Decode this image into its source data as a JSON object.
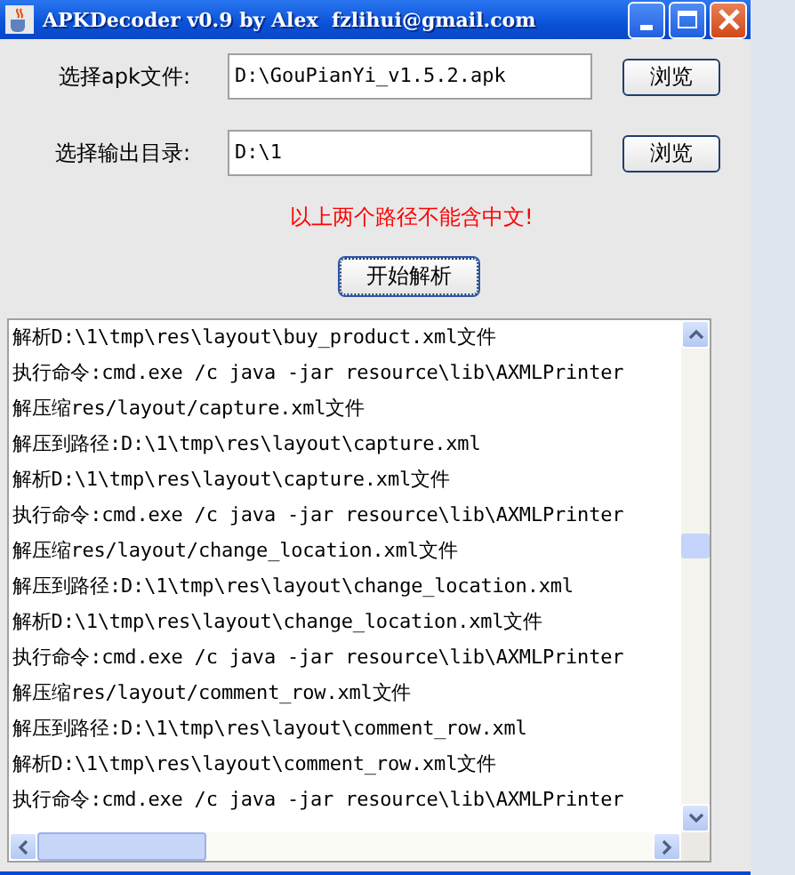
{
  "window": {
    "title": "APKDecoder v0.9 by Alex  fzlihui@gmail.com"
  },
  "fields": [
    {
      "label": "选择apk文件:",
      "value": "D:\\GouPianYi_v1.5.2.apk",
      "button": "浏览"
    },
    {
      "label": "选择输出目录:",
      "value": "D:\\1",
      "button": "浏览"
    }
  ],
  "warning": "以上两个路径不能含中文!",
  "start_button": "开始解析",
  "log": [
    "解析D:\\1\\tmp\\res\\layout\\buy_product.xml文件",
    "执行命令:cmd.exe /c java -jar resource\\lib\\AXMLPrinter",
    "解压缩res/layout/capture.xml文件",
    "解压到路径:D:\\1\\tmp\\res\\layout\\capture.xml",
    "解析D:\\1\\tmp\\res\\layout\\capture.xml文件",
    "执行命令:cmd.exe /c java -jar resource\\lib\\AXMLPrinter",
    "解压缩res/layout/change_location.xml文件",
    "解压到路径:D:\\1\\tmp\\res\\layout\\change_location.xml",
    "解析D:\\1\\tmp\\res\\layout\\change_location.xml文件",
    "执行命令:cmd.exe /c java -jar resource\\lib\\AXMLPrinter",
    "解压缩res/layout/comment_row.xml文件",
    "解压到路径:D:\\1\\tmp\\res\\layout\\comment_row.xml",
    "解析D:\\1\\tmp\\res\\layout\\comment_row.xml文件",
    "执行命令:cmd.exe /c java -jar resource\\lib\\AXMLPrinter"
  ]
}
